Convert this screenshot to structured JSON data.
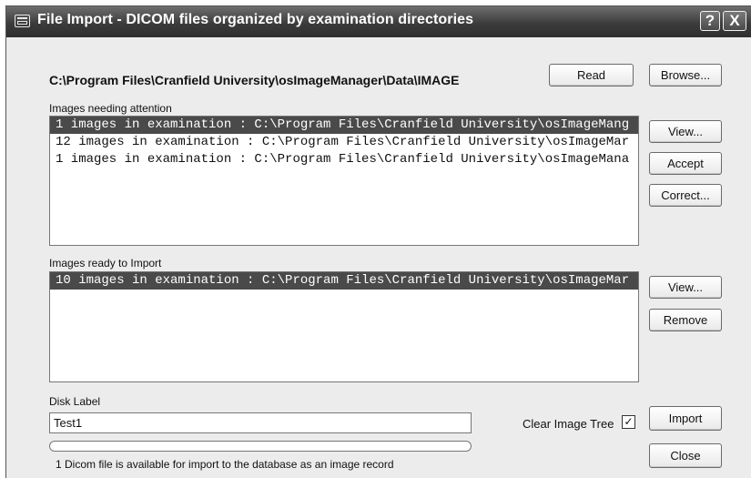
{
  "window": {
    "title": "File Import - DICOM files organized by examination directories",
    "help_label": "?",
    "close_label": "X"
  },
  "path": "C:\\Program Files\\Cranfield University\\osImageManager\\Data\\IMAGE",
  "buttons": {
    "read": "Read",
    "browse": "Browse...",
    "view_attention": "View...",
    "accept": "Accept",
    "correct": "Correct...",
    "view_ready": "View...",
    "remove": "Remove",
    "import": "Import",
    "close": "Close"
  },
  "attention": {
    "label": "Images needing attention",
    "items": [
      "1 images in examination : C:\\Program Files\\Cranfield University\\osImageMang",
      "12 images in examination : C:\\Program Files\\Cranfield University\\osImageMar",
      "1 images in examination : C:\\Program Files\\Cranfield University\\osImageMana"
    ],
    "selected_index": 0
  },
  "ready": {
    "label": "Images ready to Import",
    "items": [
      "10 images in examination : C:\\Program Files\\Cranfield University\\osImageMar"
    ],
    "selected_index": 0
  },
  "disk_label": {
    "label": "Disk Label",
    "value": "Test1"
  },
  "clear_image_tree": {
    "label": "Clear Image Tree",
    "checked": true,
    "check_glyph": "✓"
  },
  "progress": {
    "fraction": 0
  },
  "status": "1 Dicom file is available for import to the database as an image record"
}
